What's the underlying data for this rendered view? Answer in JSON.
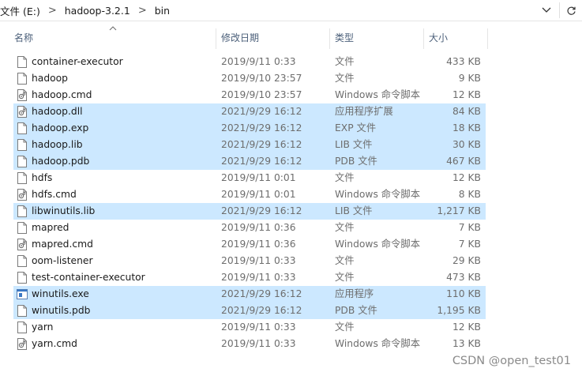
{
  "address": {
    "crumbs": [
      "文件 (E:)",
      "hadoop-3.2.1",
      "bin"
    ],
    "separator": ">"
  },
  "columns": {
    "name": "名称",
    "date": "修改日期",
    "type": "类型",
    "size": "大小"
  },
  "files": [
    {
      "name": "container-executor",
      "date": "2019/9/11 0:33",
      "type": "文件",
      "size": "433 KB",
      "selected": false,
      "icon": "file-icon"
    },
    {
      "name": "hadoop",
      "date": "2019/9/10 23:57",
      "type": "文件",
      "size": "9 KB",
      "selected": false,
      "icon": "file-icon"
    },
    {
      "name": "hadoop.cmd",
      "date": "2019/9/10 23:57",
      "type": "Windows 命令脚本",
      "size": "12 KB",
      "selected": false,
      "icon": "cmd-script-icon"
    },
    {
      "name": "hadoop.dll",
      "date": "2021/9/29 16:12",
      "type": "应用程序扩展",
      "size": "84 KB",
      "selected": true,
      "icon": "dll-icon"
    },
    {
      "name": "hadoop.exp",
      "date": "2021/9/29 16:12",
      "type": "EXP 文件",
      "size": "18 KB",
      "selected": true,
      "icon": "file-icon"
    },
    {
      "name": "hadoop.lib",
      "date": "2021/9/29 16:12",
      "type": "LIB 文件",
      "size": "30 KB",
      "selected": true,
      "icon": "file-icon"
    },
    {
      "name": "hadoop.pdb",
      "date": "2021/9/29 16:12",
      "type": "PDB 文件",
      "size": "467 KB",
      "selected": true,
      "icon": "file-icon"
    },
    {
      "name": "hdfs",
      "date": "2019/9/11 0:01",
      "type": "文件",
      "size": "12 KB",
      "selected": false,
      "icon": "file-icon"
    },
    {
      "name": "hdfs.cmd",
      "date": "2019/9/11 0:01",
      "type": "Windows 命令脚本",
      "size": "8 KB",
      "selected": false,
      "icon": "cmd-script-icon"
    },
    {
      "name": "libwinutils.lib",
      "date": "2021/9/29 16:12",
      "type": "LIB 文件",
      "size": "1,217 KB",
      "selected": true,
      "icon": "file-icon"
    },
    {
      "name": "mapred",
      "date": "2019/9/11 0:36",
      "type": "文件",
      "size": "7 KB",
      "selected": false,
      "icon": "file-icon"
    },
    {
      "name": "mapred.cmd",
      "date": "2019/9/11 0:36",
      "type": "Windows 命令脚本",
      "size": "7 KB",
      "selected": false,
      "icon": "cmd-script-icon"
    },
    {
      "name": "oom-listener",
      "date": "2019/9/11 0:33",
      "type": "文件",
      "size": "29 KB",
      "selected": false,
      "icon": "file-icon"
    },
    {
      "name": "test-container-executor",
      "date": "2019/9/11 0:33",
      "type": "文件",
      "size": "473 KB",
      "selected": false,
      "icon": "file-icon"
    },
    {
      "name": "winutils.exe",
      "date": "2021/9/29 16:12",
      "type": "应用程序",
      "size": "110 KB",
      "selected": true,
      "icon": "exe-icon"
    },
    {
      "name": "winutils.pdb",
      "date": "2021/9/29 16:12",
      "type": "PDB 文件",
      "size": "1,195 KB",
      "selected": true,
      "icon": "file-icon"
    },
    {
      "name": "yarn",
      "date": "2019/9/11 0:33",
      "type": "文件",
      "size": "12 KB",
      "selected": false,
      "icon": "file-icon"
    },
    {
      "name": "yarn.cmd",
      "date": "2019/9/11 0:33",
      "type": "Windows 命令脚本",
      "size": "13 KB",
      "selected": false,
      "icon": "cmd-script-icon"
    }
  ],
  "watermark": "CSDN @open_test01",
  "colors": {
    "selection": "#cce8ff",
    "header_text": "#4c607a",
    "secondary_text": "#6d6d6d"
  }
}
